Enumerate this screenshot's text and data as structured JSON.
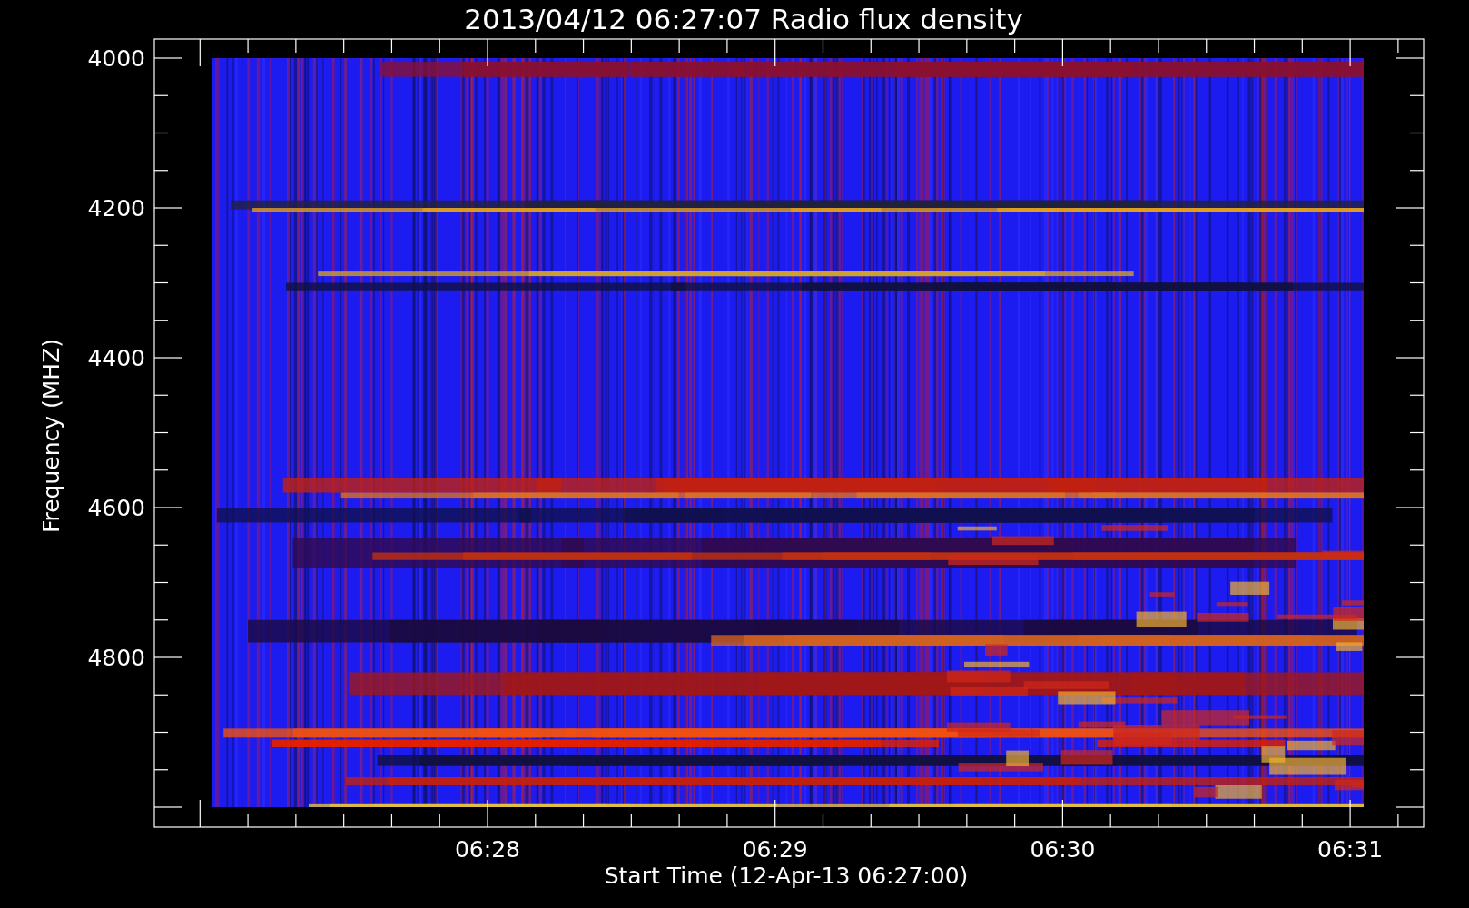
{
  "title": "2013/04/12 06:27:07 Radio flux density",
  "y_axis": {
    "label": "Frequency (MHZ)",
    "ticks": [
      "4000",
      "4200",
      "4400",
      "4600",
      "4800"
    ]
  },
  "x_axis": {
    "label": "Start Time (12-Apr-13 06:27:00)",
    "ticks": [
      "06:28",
      "06:29",
      "06:30",
      "06:31"
    ]
  }
}
